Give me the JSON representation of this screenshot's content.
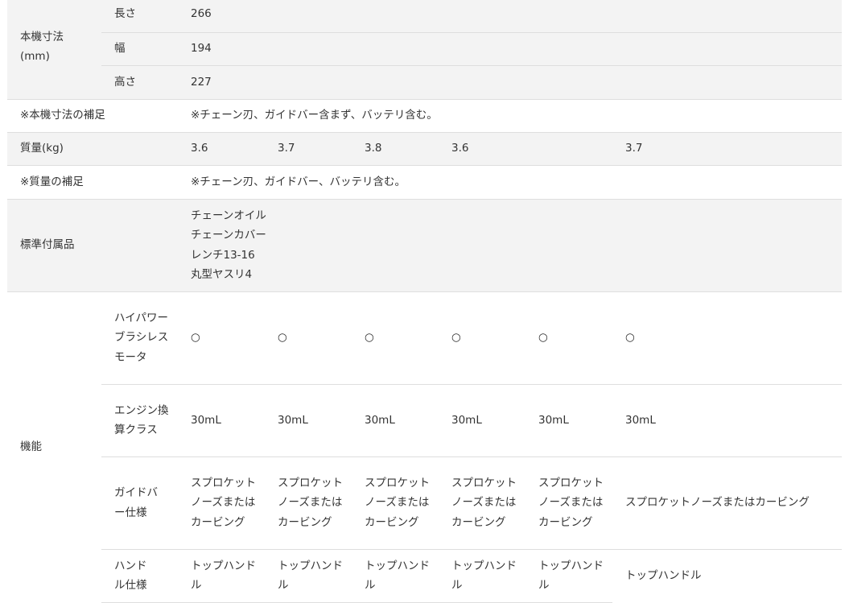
{
  "dims": {
    "label": "本機寸法(mm)",
    "length": {
      "label": "長さ",
      "value": "266"
    },
    "width": {
      "label": "幅",
      "value": "194"
    },
    "height": {
      "label": "高さ",
      "value": "227"
    }
  },
  "dims_note": {
    "label": "※本機寸法の補足",
    "value": "※チェーン刃、ガイドバー含まず、バッテリ含む。"
  },
  "mass": {
    "label": "質量(kg)",
    "values": [
      "3.6",
      "3.7",
      "3.8",
      "3.6",
      "",
      "3.7"
    ]
  },
  "mass_note": {
    "label": "※質量の補足",
    "value": "※チェーン刃、ガイドバー、バッテリ含む。"
  },
  "accessories": {
    "label": "標準付属品",
    "items": [
      "チェーンオイル",
      "チェーンカバー",
      "レンチ13-16",
      "丸型ヤスリ4"
    ]
  },
  "features": {
    "label": "機能",
    "motor": {
      "label": "ハイパワーブラシレスモータ",
      "values": [
        "○",
        "○",
        "○",
        "○",
        "○",
        "○"
      ]
    },
    "engine": {
      "label": "エンジン換算クラス",
      "values": [
        "30mL",
        "30mL",
        "30mL",
        "30mL",
        "30mL",
        "30mL"
      ]
    },
    "guide_bar": {
      "label": "ガイドバー仕様",
      "values": [
        "スプロケットノーズまたはカービング",
        "スプロケットノーズまたはカービング",
        "スプロケットノーズまたはカービング",
        "スプロケットノーズまたはカービング",
        "スプロケットノーズまたはカービング",
        "スプロケットノーズまたはカービング"
      ]
    },
    "handle": {
      "label": "ハンドル仕様",
      "values": [
        "トップハンドル",
        "トップハンドル",
        "トップハンドル",
        "トップハンドル",
        "トップハンドル",
        "トップハンドル"
      ]
    }
  }
}
